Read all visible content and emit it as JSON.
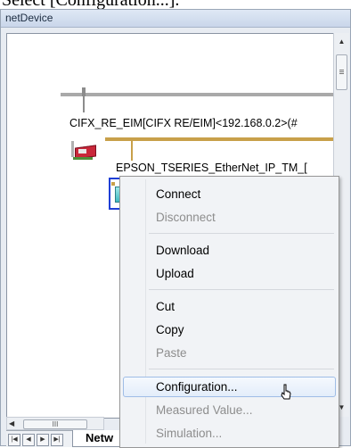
{
  "caption": "Select [Configuration...].",
  "window": {
    "title": "netDevice"
  },
  "scrollbar": {
    "h_grip": "III"
  },
  "tabs": {
    "active": "Netw"
  },
  "devices": {
    "master": "CIFX_RE_EIM[CIFX RE/EIM]<192.168.0.2>(#",
    "slave": "EPSON_TSERIES_EtherNet_IP_TM_["
  },
  "colors": {
    "bus_main": "#a9a9a9",
    "bus_ethernet": "#c8a04a",
    "selection": "#1f3fd6"
  },
  "menu": {
    "connect": "Connect",
    "disconnect": "Disconnect",
    "download": "Download",
    "upload": "Upload",
    "cut": "Cut",
    "copy": "Copy",
    "paste": "Paste",
    "configuration": "Configuration...",
    "measured_value": "Measured Value...",
    "simulation": "Simulation..."
  }
}
